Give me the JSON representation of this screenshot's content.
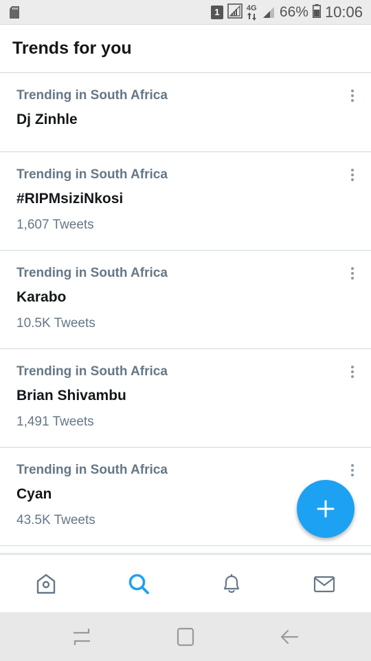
{
  "status_bar": {
    "sim_badge": "1",
    "network_type": "4G",
    "battery_percent": "66%",
    "time": "10:06",
    "icons": [
      "sd-card-icon",
      "sim-1-icon",
      "signal-icon",
      "data-arrows-icon",
      "signal-icon",
      "battery-icon"
    ]
  },
  "header": {
    "title": "Trends for you"
  },
  "trends": [
    {
      "context": "Trending in South Africa",
      "name": "Dj Zinhle",
      "count": ""
    },
    {
      "context": "Trending in South Africa",
      "name": "#RIPMsiziNkosi",
      "count": "1,607 Tweets"
    },
    {
      "context": "Trending in South Africa",
      "name": "Karabo",
      "count": "10.5K Tweets"
    },
    {
      "context": "Trending in South Africa",
      "name": "Brian Shivambu",
      "count": "1,491 Tweets"
    },
    {
      "context": "Trending in South Africa",
      "name": "Cyan",
      "count": "43.5K Tweets"
    }
  ],
  "fab": {
    "icon": "plus-icon",
    "color": "#1da1f2"
  },
  "bottom_nav": {
    "items": [
      {
        "icon": "home-icon",
        "active": false
      },
      {
        "icon": "search-icon",
        "active": true
      },
      {
        "icon": "bell-icon",
        "active": false
      },
      {
        "icon": "mail-icon",
        "active": false
      }
    ],
    "active_color": "#1da1f2",
    "inactive_color": "#657786"
  },
  "system_nav": {
    "icons": [
      "recent-apps-icon",
      "home-square-icon",
      "back-arrow-icon"
    ]
  }
}
